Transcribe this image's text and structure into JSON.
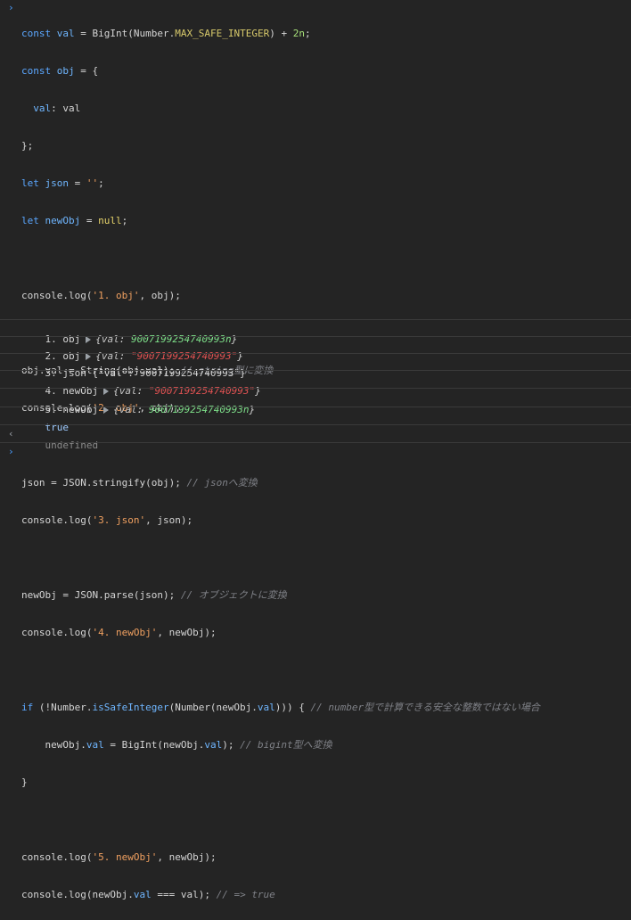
{
  "input": {
    "chevron": "›",
    "lines": {
      "l1": {
        "kw": "const",
        "var": "val",
        "eq": " = ",
        "fn": "BigInt",
        "p1": "(Number.",
        "const": "MAX_SAFE_INTEGER",
        "p2": ") + ",
        "num": "2n",
        "end": ";"
      },
      "l2": {
        "kw": "const",
        "var": "obj",
        "rest": " = {"
      },
      "l3": {
        "indent": "  ",
        "key": "val",
        "rest": ": val"
      },
      "l4": {
        "text": "};"
      },
      "l5": {
        "kw": "let",
        "var": "json",
        "eq": " = ",
        "str": "''",
        "end": ";"
      },
      "l6": {
        "kw": "let",
        "var": "newObj",
        "eq": " = ",
        "nullkw": "null",
        "end": ";"
      },
      "l8": {
        "pre": "console.log(",
        "str": "'1. obj'",
        "post": ", obj);"
      },
      "l10": {
        "pre": "obj.val = String(obj.val); ",
        "cmt": "// string型に変換"
      },
      "l11": {
        "pre": "console.log(",
        "str": "'2. obj'",
        "post": ", obj);"
      },
      "l13": {
        "pre": "json = JSON.",
        "fn": "stringify",
        "post": "(obj); ",
        "cmt": "// jsonへ変換"
      },
      "l14": {
        "pre": "console.log(",
        "str": "'3. json'",
        "post": ", json);"
      },
      "l16": {
        "pre": "newObj = JSON.",
        "fn": "parse",
        "post": "(json); ",
        "cmt": "// オブジェクトに変換"
      },
      "l17": {
        "pre": "console.log(",
        "str": "'4. newObj'",
        "post": ", newObj);"
      },
      "l19": {
        "kw": "if",
        "pre": " (!Number.",
        "fn": "isSafeInteger",
        "mid": "(Number(newObj.",
        "var": "val",
        "post": "))) { ",
        "cmt": "// number型で計算できる安全な整数ではない場合"
      },
      "l20": {
        "pre": "    newObj.",
        "var": "val",
        "post": " = BigInt(newObj.",
        "var2": "val",
        "post2": "); ",
        "cmt": "// bigint型へ変換"
      },
      "l21": {
        "text": "}"
      },
      "l23": {
        "pre": "console.log(",
        "str": "'5. newObj'",
        "post": ", newObj);"
      },
      "l24": {
        "pre": "console.log(newObj.",
        "var": "val",
        "post": " === val); ",
        "cmt": "// => true"
      },
      "l25": {
        "cmt": "// --------------------------------------------------------------------------"
      }
    }
  },
  "output": {
    "r1": {
      "label": "1. obj",
      "open": "{",
      "key": "val",
      "colon": ": ",
      "value": "9007199254740993n",
      "close": "}"
    },
    "r2": {
      "label": "2. obj",
      "open": "{",
      "key": "val",
      "colon": ": ",
      "value": "\"9007199254740993\"",
      "close": "}"
    },
    "r3": {
      "text": "3. json {\"val\":\"9007199254740993\"}"
    },
    "r4": {
      "label": "4. newObj",
      "open": "{",
      "key": "val",
      "colon": ": ",
      "value": "\"9007199254740993\"",
      "close": "}"
    },
    "r5": {
      "label": "5. newObj",
      "open": "{",
      "key": "val",
      "colon": ": ",
      "value": "9007199254740993n",
      "close": "}"
    },
    "r6": {
      "text": "true"
    },
    "r7": {
      "arrow": "‹",
      "text": "undefined"
    },
    "prompt": "›"
  }
}
